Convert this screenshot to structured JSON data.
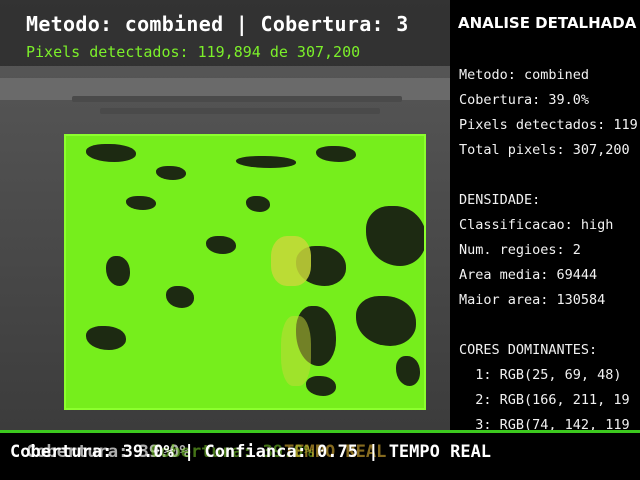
{
  "header": {
    "title": "Metodo: combined | Cobertura: 3",
    "subtitle": "Pixels detectados: 119,894 de 307,200"
  },
  "panel": {
    "title": "ANALISE DETALHADA",
    "lines": [
      "Metodo: combined",
      "Cobertura: 39.0%",
      "Pixels detectados: 119",
      "Total pixels: 307,200",
      "DENSIDADE:",
      "Classificacao: high",
      "Num. regioes: 2",
      "Area media: 69444",
      "Maior area: 130584",
      "CORES DOMINANTES:",
      "  1: RGB(25, 69, 48)",
      "  2: RGB(166, 211, 19",
      "  3: RGB(74, 142, 119"
    ]
  },
  "status": {
    "line_main": "Cobertura: 39.0% | Confianca: 0.75 | TEMPO REAL",
    "overlay_a": "Cobertura: 39.0%",
    "overlay_b": "Cobertura: 39.0%",
    "overlay_c": "TEMPO REAL"
  },
  "colors": {
    "mask_green": "#76ee1c",
    "accent_green": "#7cf02a",
    "panel_bg": "#000000"
  }
}
